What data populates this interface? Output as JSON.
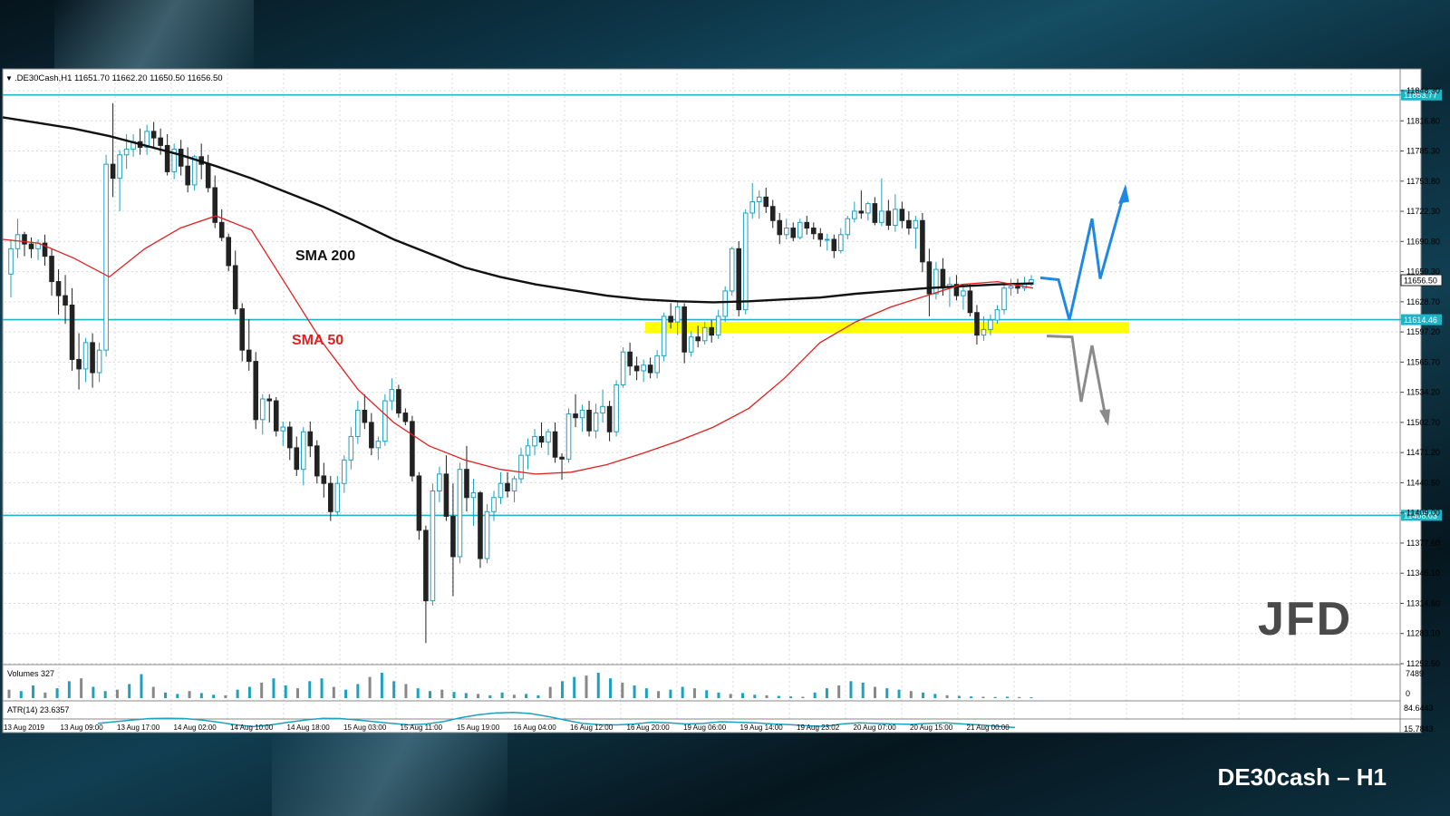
{
  "footer_title": "DE30cash – H1",
  "logo_text": "JFD",
  "colors": {
    "bull": "#1ea0c0",
    "bear": "#222222",
    "sma200": "#111111",
    "sma50": "#e02020",
    "hline": "#1fb3c4",
    "zone": "#ffff00",
    "arrow_up": "#1e88e5",
    "arrow_down": "#8a8a8a",
    "grid": "#d8d8d8"
  },
  "chart_data": {
    "type": "candlestick",
    "symbol_header": ".DE30Cash,H1  11651.70 11662.20 11650.50 11656.50",
    "price_axis_ticks": [
      "11848.30",
      "11816.80",
      "11785.30",
      "11753.80",
      "11722.30",
      "11690.80",
      "11659.30",
      "11628.70",
      "11597.20",
      "11565.70",
      "11534.20",
      "11502.70",
      "11471.20",
      "11440.50",
      "11409.00",
      "11377.60",
      "11346.10",
      "11314.60",
      "11283.10",
      "11252.50"
    ],
    "time_axis_ticks": [
      "13 Aug 2019",
      "13 Aug 09:00",
      "13 Aug 17:00",
      "14 Aug 02:00",
      "14 Aug 10:00",
      "14 Aug 18:00",
      "15 Aug 03:00",
      "15 Aug 11:00",
      "15 Aug 19:00",
      "16 Aug 04:00",
      "16 Aug 12:00",
      "16 Aug 20:00",
      "19 Aug 06:00",
      "19 Aug 14:00",
      "19 Aug 23:02",
      "20 Aug 07:00",
      "20 Aug 15:00",
      "21 Aug 00:00"
    ],
    "ylim": [
      11249,
      11868
    ],
    "horizontal_levels": [
      {
        "label": "11853.77",
        "value": 11853.77
      },
      {
        "label": "11614.46",
        "value": 11614.46
      },
      {
        "label": "11406.03",
        "value": 11406.03
      }
    ],
    "current_price": {
      "label": "11656.50",
      "value": 11656.5
    },
    "support_zone": [
      11600,
      11612
    ],
    "annotations": [
      {
        "text": "SMA 200",
        "color": "#111111"
      },
      {
        "text": "SMA 50",
        "color": "#e02020"
      }
    ],
    "candles": [
      [
        11663,
        11700,
        11638,
        11690
      ],
      [
        11690,
        11722,
        11680,
        11705
      ],
      [
        11705,
        11708,
        11682,
        11695
      ],
      [
        11695,
        11702,
        11680,
        11690
      ],
      [
        11690,
        11700,
        11678,
        11696
      ],
      [
        11696,
        11705,
        11672,
        11682
      ],
      [
        11682,
        11690,
        11640,
        11655
      ],
      [
        11655,
        11668,
        11620,
        11640
      ],
      [
        11640,
        11662,
        11610,
        11630
      ],
      [
        11630,
        11648,
        11560,
        11572
      ],
      [
        11572,
        11600,
        11540,
        11562
      ],
      [
        11562,
        11595,
        11548,
        11590
      ],
      [
        11590,
        11600,
        11542,
        11558
      ],
      [
        11558,
        11590,
        11548,
        11582
      ],
      [
        11582,
        11790,
        11575,
        11780
      ],
      [
        11780,
        11845,
        11745,
        11765
      ],
      [
        11765,
        11795,
        11730,
        11790
      ],
      [
        11790,
        11812,
        11775,
        11796
      ],
      [
        11796,
        11812,
        11788,
        11804
      ],
      [
        11804,
        11818,
        11790,
        11798
      ],
      [
        11798,
        11822,
        11790,
        11815
      ],
      [
        11815,
        11825,
        11798,
        11808
      ],
      [
        11808,
        11818,
        11790,
        11800
      ],
      [
        11800,
        11812,
        11768,
        11772
      ],
      [
        11772,
        11802,
        11764,
        11796
      ],
      [
        11796,
        11806,
        11768,
        11778
      ],
      [
        11778,
        11798,
        11750,
        11758
      ],
      [
        11758,
        11790,
        11752,
        11788
      ],
      [
        11788,
        11802,
        11764,
        11780
      ],
      [
        11780,
        11790,
        11750,
        11755
      ],
      [
        11755,
        11768,
        11712,
        11718
      ],
      [
        11718,
        11732,
        11698,
        11702
      ],
      [
        11702,
        11706,
        11666,
        11672
      ],
      [
        11672,
        11688,
        11620,
        11626
      ],
      [
        11626,
        11632,
        11570,
        11582
      ],
      [
        11582,
        11615,
        11560,
        11570
      ],
      [
        11570,
        11580,
        11498,
        11508
      ],
      [
        11508,
        11535,
        11492,
        11530
      ],
      [
        11530,
        11535,
        11505,
        11528
      ],
      [
        11528,
        11532,
        11490,
        11496
      ],
      [
        11496,
        11506,
        11480,
        11500
      ],
      [
        11500,
        11506,
        11465,
        11478
      ],
      [
        11478,
        11490,
        11448,
        11455
      ],
      [
        11455,
        11500,
        11438,
        11495
      ],
      [
        11495,
        11506,
        11468,
        11480
      ],
      [
        11480,
        11486,
        11440,
        11448
      ],
      [
        11448,
        11462,
        11425,
        11440
      ],
      [
        11440,
        11448,
        11400,
        11410
      ],
      [
        11410,
        11448,
        11405,
        11440
      ],
      [
        11440,
        11470,
        11430,
        11465
      ],
      [
        11465,
        11500,
        11455,
        11490
      ],
      [
        11490,
        11528,
        11482,
        11518
      ],
      [
        11518,
        11535,
        11498,
        11505
      ],
      [
        11505,
        11515,
        11470,
        11478
      ],
      [
        11478,
        11490,
        11465,
        11485
      ],
      [
        11485,
        11535,
        11480,
        11528
      ],
      [
        11528,
        11552,
        11518,
        11540
      ],
      [
        11540,
        11545,
        11510,
        11515
      ],
      [
        11515,
        11520,
        11502,
        11506
      ],
      [
        11506,
        11512,
        11442,
        11448
      ],
      [
        11448,
        11452,
        11380,
        11390
      ],
      [
        11390,
        11395,
        11270,
        11315
      ],
      [
        11315,
        11440,
        11310,
        11432
      ],
      [
        11432,
        11458,
        11420,
        11450
      ],
      [
        11450,
        11470,
        11400,
        11405
      ],
      [
        11405,
        11440,
        11320,
        11362
      ],
      [
        11362,
        11462,
        11355,
        11455
      ],
      [
        11455,
        11480,
        11410,
        11425
      ],
      [
        11425,
        11445,
        11395,
        11430
      ],
      [
        11430,
        11432,
        11350,
        11360
      ],
      [
        11360,
        11418,
        11355,
        11410
      ],
      [
        11410,
        11432,
        11400,
        11425
      ],
      [
        11425,
        11452,
        11418,
        11440
      ],
      [
        11440,
        11452,
        11425,
        11432
      ],
      [
        11432,
        11448,
        11420,
        11445
      ],
      [
        11445,
        11478,
        11440,
        11470
      ],
      [
        11470,
        11488,
        11455,
        11480
      ],
      [
        11480,
        11498,
        11470,
        11490
      ],
      [
        11490,
        11505,
        11478,
        11484
      ],
      [
        11484,
        11498,
        11470,
        11495
      ],
      [
        11495,
        11505,
        11462,
        11468
      ],
      [
        11468,
        11472,
        11444,
        11466
      ],
      [
        11466,
        11520,
        11462,
        11514
      ],
      [
        11514,
        11535,
        11500,
        11510
      ],
      [
        11510,
        11524,
        11495,
        11518
      ],
      [
        11518,
        11528,
        11490,
        11496
      ],
      [
        11496,
        11525,
        11488,
        11515
      ],
      [
        11515,
        11540,
        11505,
        11522
      ],
      [
        11522,
        11528,
        11485,
        11495
      ],
      [
        11495,
        11550,
        11490,
        11545
      ],
      [
        11545,
        11585,
        11542,
        11580
      ],
      [
        11580,
        11590,
        11555,
        11565
      ],
      [
        11565,
        11575,
        11550,
        11560
      ],
      [
        11560,
        11572,
        11548,
        11566
      ],
      [
        11566,
        11574,
        11552,
        11558
      ],
      [
        11558,
        11582,
        11552,
        11576
      ],
      [
        11576,
        11622,
        11570,
        11618
      ],
      [
        11618,
        11632,
        11605,
        11612
      ],
      [
        11612,
        11635,
        11598,
        11628
      ],
      [
        11628,
        11632,
        11568,
        11580
      ],
      [
        11580,
        11602,
        11575,
        11596
      ],
      [
        11596,
        11608,
        11585,
        11592
      ],
      [
        11592,
        11612,
        11588,
        11606
      ],
      [
        11606,
        11614,
        11590,
        11598
      ],
      [
        11598,
        11625,
        11594,
        11618
      ],
      [
        11618,
        11650,
        11612,
        11645
      ],
      [
        11645,
        11692,
        11640,
        11690
      ],
      [
        11690,
        11698,
        11618,
        11625
      ],
      [
        11625,
        11732,
        11620,
        11728
      ],
      [
        11728,
        11760,
        11722,
        11740
      ],
      [
        11740,
        11752,
        11722,
        11745
      ],
      [
        11745,
        11755,
        11728,
        11735
      ],
      [
        11735,
        11742,
        11712,
        11720
      ],
      [
        11720,
        11728,
        11695,
        11705
      ],
      [
        11705,
        11722,
        11700,
        11712
      ],
      [
        11712,
        11718,
        11698,
        11702
      ],
      [
        11702,
        11722,
        11700,
        11718
      ],
      [
        11718,
        11725,
        11705,
        11712
      ],
      [
        11712,
        11718,
        11700,
        11706
      ],
      [
        11706,
        11712,
        11692,
        11700
      ],
      [
        11700,
        11706,
        11688,
        11700
      ],
      [
        11700,
        11705,
        11680,
        11688
      ],
      [
        11688,
        11712,
        11685,
        11705
      ],
      [
        11705,
        11725,
        11700,
        11722
      ],
      [
        11722,
        11740,
        11718,
        11730
      ],
      [
        11730,
        11752,
        11722,
        11728
      ],
      [
        11728,
        11740,
        11720,
        11738
      ],
      [
        11738,
        11745,
        11715,
        11718
      ],
      [
        11718,
        11765,
        11714,
        11730
      ],
      [
        11730,
        11742,
        11710,
        11715
      ],
      [
        11715,
        11748,
        11708,
        11732
      ],
      [
        11732,
        11740,
        11712,
        11720
      ],
      [
        11720,
        11730,
        11705,
        11712
      ],
      [
        11712,
        11725,
        11690,
        11720
      ],
      [
        11720,
        11728,
        11665,
        11676
      ],
      [
        11676,
        11690,
        11618,
        11642
      ],
      [
        11642,
        11676,
        11636,
        11668
      ],
      [
        11668,
        11680,
        11640,
        11648
      ],
      [
        11648,
        11660,
        11628,
        11652
      ],
      [
        11652,
        11662,
        11635,
        11640
      ],
      [
        11640,
        11652,
        11625,
        11645
      ],
      [
        11645,
        11652,
        11618,
        11622
      ],
      [
        11622,
        11630,
        11588,
        11598
      ],
      [
        11598,
        11618,
        11592,
        11604
      ],
      [
        11604,
        11620,
        11598,
        11614
      ],
      [
        11614,
        11630,
        11610,
        11625
      ],
      [
        11625,
        11652,
        11620,
        11648
      ],
      [
        11648,
        11658,
        11640,
        11650
      ],
      [
        11650,
        11658,
        11642,
        11648
      ],
      [
        11648,
        11660,
        11645,
        11652
      ],
      [
        11652,
        11662,
        11650,
        11657
      ]
    ],
    "sma200": [
      11830,
      11824,
      11818,
      11810,
      11800,
      11790,
      11778,
      11765,
      11750,
      11735,
      11718,
      11700,
      11685,
      11670,
      11660,
      11652,
      11646,
      11640,
      11636,
      11634,
      11633,
      11634,
      11636,
      11638,
      11642,
      11645,
      11648,
      11650,
      11652,
      11653
    ],
    "sma50": [
      11700,
      11696,
      11680,
      11660,
      11690,
      11712,
      11725,
      11710,
      11650,
      11590,
      11540,
      11505,
      11480,
      11465,
      11455,
      11450,
      11452,
      11460,
      11472,
      11485,
      11500,
      11520,
      11552,
      11590,
      11612,
      11628,
      11640,
      11652,
      11655,
      11648
    ],
    "volume": {
      "label": "Volumes 327",
      "ticks": [
        "7489",
        "0"
      ],
      "values": [
        30,
        25,
        45,
        20,
        35,
        60,
        70,
        40,
        25,
        30,
        50,
        85,
        40,
        20,
        15,
        25,
        18,
        12,
        10,
        30,
        40,
        55,
        70,
        45,
        35,
        60,
        70,
        40,
        30,
        50,
        75,
        90,
        60,
        50,
        35,
        25,
        30,
        22,
        18,
        15,
        10,
        20,
        12,
        15,
        10,
        40,
        60,
        75,
        80,
        90,
        70,
        55,
        45,
        35,
        25,
        30,
        40,
        35,
        28,
        20,
        15,
        18,
        12,
        10,
        8,
        6,
        5,
        20,
        35,
        45,
        60,
        55,
        40,
        35,
        30,
        25,
        20,
        15,
        10,
        8,
        6,
        5,
        4,
        5,
        4,
        3
      ]
    },
    "atr": {
      "label": "ATR(14) 23.6357",
      "ticks": [
        "84.6443",
        "15.7843"
      ],
      "values": [
        38,
        44,
        50,
        55,
        56,
        55,
        50,
        42,
        33,
        27,
        33,
        42,
        50,
        56,
        55,
        50,
        44,
        38,
        33,
        36,
        45,
        58,
        68,
        74,
        76,
        72,
        62,
        50,
        38,
        34,
        33,
        36,
        42,
        40,
        36,
        38,
        44,
        42,
        40,
        36,
        34,
        30,
        28,
        36,
        40,
        38,
        36,
        35,
        38,
        40,
        36,
        33,
        28,
        24
      ]
    }
  }
}
